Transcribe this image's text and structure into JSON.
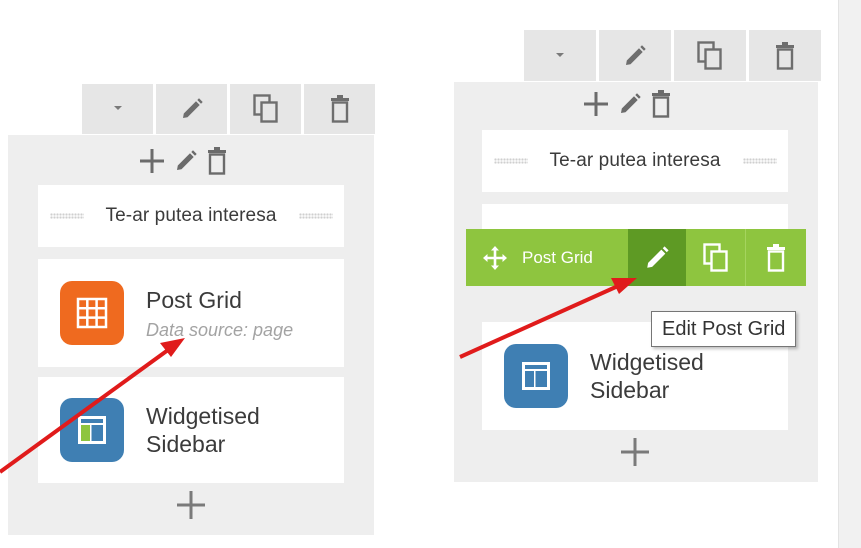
{
  "left_panel": {
    "heading_text": "Te-ar putea interesa",
    "post_grid": {
      "title": "Post Grid",
      "subtitle": "Data source: page"
    },
    "widgetised_sidebar": {
      "title_line1": "Widgetised",
      "title_line2": "Sidebar"
    }
  },
  "right_panel": {
    "heading_text": "Te-ar putea interesa",
    "widgetised_sidebar": {
      "title_line1": "Widgetised",
      "title_line2": "Sidebar"
    },
    "hover_toolbar": {
      "label": "Post Grid"
    },
    "tooltip": "Edit Post Grid"
  },
  "icons": {
    "toolbar": [
      "chevron-down-icon",
      "pencil-icon",
      "duplicate-icon",
      "trash-icon"
    ],
    "column_actions": [
      "plus-icon",
      "pencil-icon",
      "trash-icon"
    ],
    "post_grid_widget": "grid-icon",
    "sidebar_widget": "sidebar-layout-icon",
    "move": "move-icon"
  },
  "colors": {
    "toolbar_bg": "#e6e6e6",
    "column_bg": "#eeeeee",
    "post_grid_icon": "#ef6a1f",
    "sidebar_icon": "#3f7fb3",
    "hover_bar_green": "#8ec53f",
    "hover_bar_dark_green": "#5e9a24",
    "annotation_arrow": "#e01b1b"
  }
}
